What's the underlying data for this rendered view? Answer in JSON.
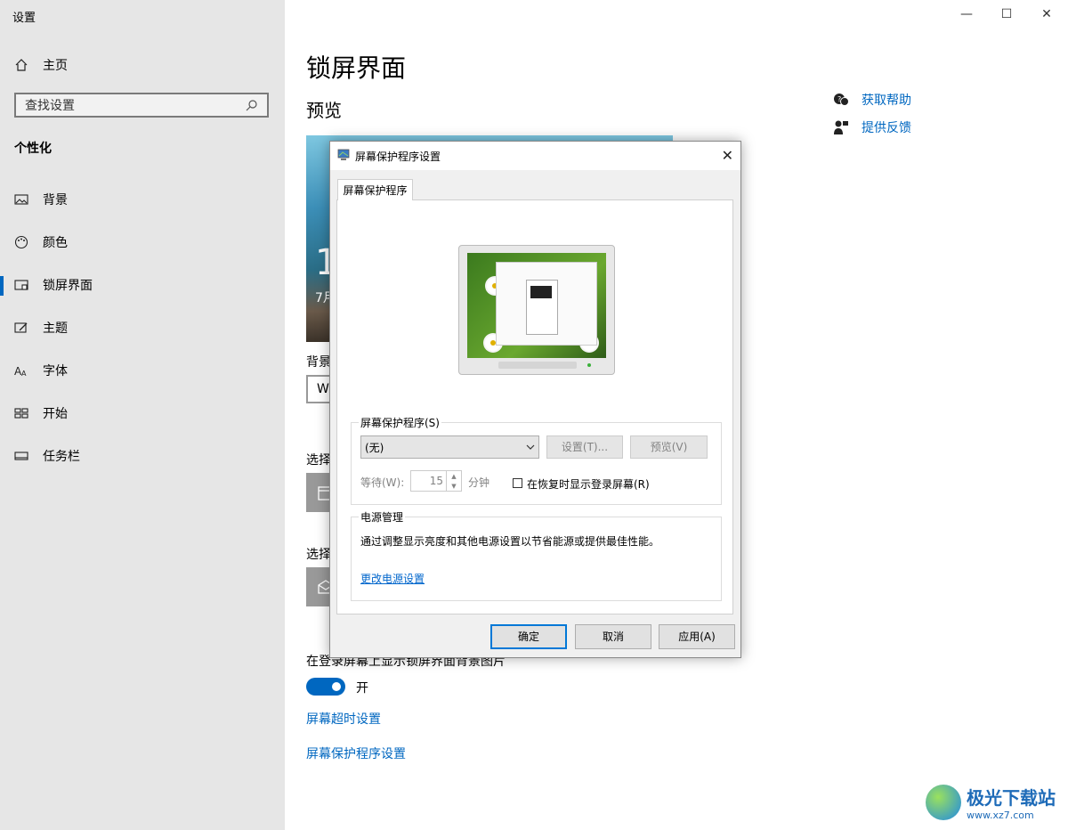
{
  "app": {
    "title": "设置"
  },
  "window_controls": {
    "minimize": "—",
    "maximize": "☐",
    "close": "✕"
  },
  "sidebar": {
    "home": "主页",
    "search_placeholder": "查找设置",
    "section": "个性化",
    "items": [
      {
        "label": "背景",
        "icon": "image-icon"
      },
      {
        "label": "颜色",
        "icon": "palette-icon"
      },
      {
        "label": "锁屏界面",
        "icon": "lock-screen-icon",
        "selected": true
      },
      {
        "label": "主题",
        "icon": "theme-icon"
      },
      {
        "label": "字体",
        "icon": "font-icon"
      },
      {
        "label": "开始",
        "icon": "start-icon"
      },
      {
        "label": "任务栏",
        "icon": "taskbar-icon"
      }
    ]
  },
  "main": {
    "title": "锁屏界面",
    "preview_heading": "预览",
    "preview_time": "1",
    "preview_date": "7月",
    "background_label": "背景",
    "background_value": "W",
    "select_label_1": "选择",
    "select_label_2": "选择",
    "toggle_label": "在登录屏幕上显示锁屏界面背景图片",
    "toggle_state": "开",
    "link_timeout": "屏幕超时设置",
    "link_screensaver": "屏幕保护程序设置"
  },
  "help": {
    "get_help": "获取帮助",
    "feedback": "提供反馈"
  },
  "dialog": {
    "title": "屏幕保护程序设置",
    "tab": "屏幕保护程序",
    "screensaver_group": "屏幕保护程序(S)",
    "combo_value": "(无)",
    "settings_btn": "设置(T)...",
    "preview_btn": "预览(V)",
    "wait_label": "等待(W):",
    "wait_value": "15",
    "minutes": "分钟",
    "resume_checkbox": "在恢复时显示登录屏幕(R)",
    "power_group": "电源管理",
    "power_text": "通过调整显示亮度和其他电源设置以节省能源或提供最佳性能。",
    "power_link": "更改电源设置",
    "ok": "确定",
    "cancel": "取消",
    "apply": "应用(A)"
  },
  "watermark": {
    "main": "极光下载站",
    "sub": "www.xz7.com"
  },
  "colors": {
    "accent": "#0067c0",
    "sidebar_bg": "#e6e6e6",
    "dialog_bg": "#f0f0f0"
  }
}
